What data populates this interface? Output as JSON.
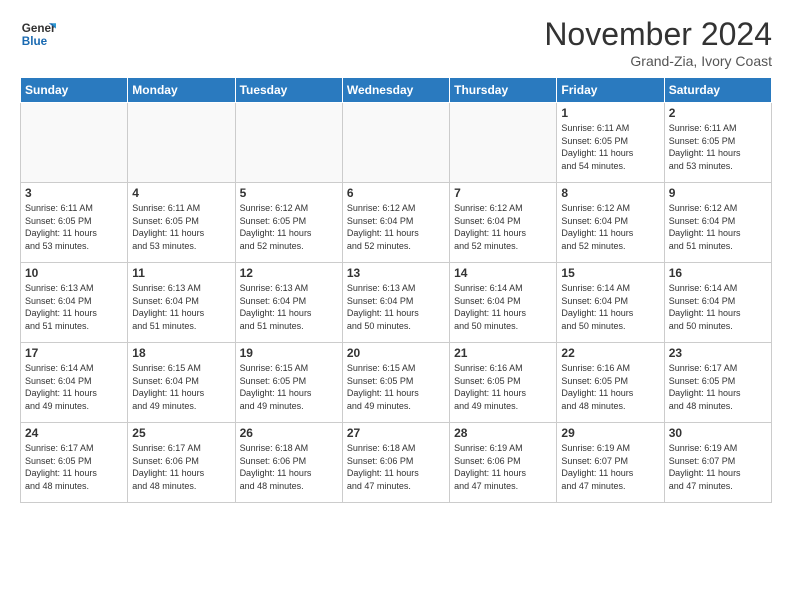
{
  "logo": {
    "line1": "General",
    "line2": "Blue"
  },
  "title": "November 2024",
  "location": "Grand-Zia, Ivory Coast",
  "weekdays": [
    "Sunday",
    "Monday",
    "Tuesday",
    "Wednesday",
    "Thursday",
    "Friday",
    "Saturday"
  ],
  "weeks": [
    [
      {
        "day": "",
        "info": ""
      },
      {
        "day": "",
        "info": ""
      },
      {
        "day": "",
        "info": ""
      },
      {
        "day": "",
        "info": ""
      },
      {
        "day": "",
        "info": ""
      },
      {
        "day": "1",
        "info": "Sunrise: 6:11 AM\nSunset: 6:05 PM\nDaylight: 11 hours\nand 54 minutes."
      },
      {
        "day": "2",
        "info": "Sunrise: 6:11 AM\nSunset: 6:05 PM\nDaylight: 11 hours\nand 53 minutes."
      }
    ],
    [
      {
        "day": "3",
        "info": "Sunrise: 6:11 AM\nSunset: 6:05 PM\nDaylight: 11 hours\nand 53 minutes."
      },
      {
        "day": "4",
        "info": "Sunrise: 6:11 AM\nSunset: 6:05 PM\nDaylight: 11 hours\nand 53 minutes."
      },
      {
        "day": "5",
        "info": "Sunrise: 6:12 AM\nSunset: 6:05 PM\nDaylight: 11 hours\nand 52 minutes."
      },
      {
        "day": "6",
        "info": "Sunrise: 6:12 AM\nSunset: 6:04 PM\nDaylight: 11 hours\nand 52 minutes."
      },
      {
        "day": "7",
        "info": "Sunrise: 6:12 AM\nSunset: 6:04 PM\nDaylight: 11 hours\nand 52 minutes."
      },
      {
        "day": "8",
        "info": "Sunrise: 6:12 AM\nSunset: 6:04 PM\nDaylight: 11 hours\nand 52 minutes."
      },
      {
        "day": "9",
        "info": "Sunrise: 6:12 AM\nSunset: 6:04 PM\nDaylight: 11 hours\nand 51 minutes."
      }
    ],
    [
      {
        "day": "10",
        "info": "Sunrise: 6:13 AM\nSunset: 6:04 PM\nDaylight: 11 hours\nand 51 minutes."
      },
      {
        "day": "11",
        "info": "Sunrise: 6:13 AM\nSunset: 6:04 PM\nDaylight: 11 hours\nand 51 minutes."
      },
      {
        "day": "12",
        "info": "Sunrise: 6:13 AM\nSunset: 6:04 PM\nDaylight: 11 hours\nand 51 minutes."
      },
      {
        "day": "13",
        "info": "Sunrise: 6:13 AM\nSunset: 6:04 PM\nDaylight: 11 hours\nand 50 minutes."
      },
      {
        "day": "14",
        "info": "Sunrise: 6:14 AM\nSunset: 6:04 PM\nDaylight: 11 hours\nand 50 minutes."
      },
      {
        "day": "15",
        "info": "Sunrise: 6:14 AM\nSunset: 6:04 PM\nDaylight: 11 hours\nand 50 minutes."
      },
      {
        "day": "16",
        "info": "Sunrise: 6:14 AM\nSunset: 6:04 PM\nDaylight: 11 hours\nand 50 minutes."
      }
    ],
    [
      {
        "day": "17",
        "info": "Sunrise: 6:14 AM\nSunset: 6:04 PM\nDaylight: 11 hours\nand 49 minutes."
      },
      {
        "day": "18",
        "info": "Sunrise: 6:15 AM\nSunset: 6:04 PM\nDaylight: 11 hours\nand 49 minutes."
      },
      {
        "day": "19",
        "info": "Sunrise: 6:15 AM\nSunset: 6:05 PM\nDaylight: 11 hours\nand 49 minutes."
      },
      {
        "day": "20",
        "info": "Sunrise: 6:15 AM\nSunset: 6:05 PM\nDaylight: 11 hours\nand 49 minutes."
      },
      {
        "day": "21",
        "info": "Sunrise: 6:16 AM\nSunset: 6:05 PM\nDaylight: 11 hours\nand 49 minutes."
      },
      {
        "day": "22",
        "info": "Sunrise: 6:16 AM\nSunset: 6:05 PM\nDaylight: 11 hours\nand 48 minutes."
      },
      {
        "day": "23",
        "info": "Sunrise: 6:17 AM\nSunset: 6:05 PM\nDaylight: 11 hours\nand 48 minutes."
      }
    ],
    [
      {
        "day": "24",
        "info": "Sunrise: 6:17 AM\nSunset: 6:05 PM\nDaylight: 11 hours\nand 48 minutes."
      },
      {
        "day": "25",
        "info": "Sunrise: 6:17 AM\nSunset: 6:06 PM\nDaylight: 11 hours\nand 48 minutes."
      },
      {
        "day": "26",
        "info": "Sunrise: 6:18 AM\nSunset: 6:06 PM\nDaylight: 11 hours\nand 48 minutes."
      },
      {
        "day": "27",
        "info": "Sunrise: 6:18 AM\nSunset: 6:06 PM\nDaylight: 11 hours\nand 47 minutes."
      },
      {
        "day": "28",
        "info": "Sunrise: 6:19 AM\nSunset: 6:06 PM\nDaylight: 11 hours\nand 47 minutes."
      },
      {
        "day": "29",
        "info": "Sunrise: 6:19 AM\nSunset: 6:07 PM\nDaylight: 11 hours\nand 47 minutes."
      },
      {
        "day": "30",
        "info": "Sunrise: 6:19 AM\nSunset: 6:07 PM\nDaylight: 11 hours\nand 47 minutes."
      }
    ]
  ]
}
